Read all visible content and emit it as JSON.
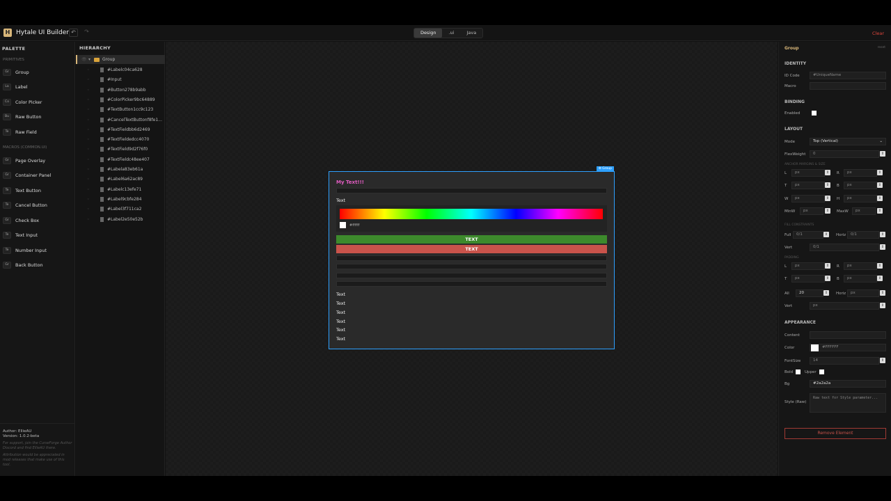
{
  "app": {
    "title": "Hytale UI Builder",
    "logo": "H",
    "undo": "↶",
    "redo": "↷",
    "clear_label": "Clear"
  },
  "modes": [
    {
      "label": "Design",
      "active": true
    },
    {
      "label": ".ui"
    },
    {
      "label": "Java"
    }
  ],
  "palette": {
    "title": "PALETTE",
    "primitives_title": "PRIMITIVES",
    "primitives": [
      {
        "badge": "Gr",
        "label": "Group"
      },
      {
        "badge": "La",
        "label": "Label"
      },
      {
        "badge": "Co",
        "label": "Color Picker"
      },
      {
        "badge": "Bu",
        "label": "Raw Button"
      },
      {
        "badge": "Te",
        "label": "Raw Field"
      }
    ],
    "macros_title": "MACROS (COMMON.UI)",
    "macros": [
      {
        "badge": "Gr",
        "label": "Page Overlay"
      },
      {
        "badge": "Gr",
        "label": "Container Panel"
      },
      {
        "badge": "Te",
        "label": "Text Button"
      },
      {
        "badge": "Te",
        "label": "Cancel Button"
      },
      {
        "badge": "Gr",
        "label": "Check Box"
      },
      {
        "badge": "Te",
        "label": "Text Input"
      },
      {
        "badge": "Te",
        "label": "Number Input"
      },
      {
        "badge": "Gr",
        "label": "Back Button"
      }
    ],
    "footer": {
      "author": "Author: EllieAU",
      "version": "Version: 1.0.2-beta",
      "support": "For support, join the CurseForge Author Discord and find EllieAU there.",
      "attribution": "Attribution would be appreciated in mod releases that make use of this tool."
    }
  },
  "hierarchy": {
    "title": "HIERARCHY",
    "root": "Group",
    "items": [
      "#Labelc04ca628",
      "#Input",
      "#Button278b9abb",
      "#ColorPicker9bc64889",
      "#TextButton1cc9c123",
      "#CancelTextButtonf8fe1...",
      "#TextFieldbb6d2469",
      "#TextFieldedcc4070",
      "#TextField9d2f76f0",
      "#TextFieldc48ee407",
      "#Labela83eb61a",
      "#Label6a62ac89",
      "#Labelc13efe71",
      "#Label9cbfe284",
      "#Label3f711ca2",
      "#Label2e50e52b"
    ]
  },
  "canvas": {
    "group_tag": "⚙ Group",
    "title_text": "My Text!!!",
    "text_label": "Text",
    "picker_hex": "#ffffff",
    "primary_button": "TEXT",
    "cancel_button": "TEXT",
    "labels": [
      "Text",
      "Text",
      "Text",
      "Text",
      "Text",
      "Text"
    ],
    "colors": {
      "title": "#e05cc0",
      "primary_button": "#3d8a2c",
      "cancel_button": "#c9534b",
      "selection": "#2ea0ff"
    }
  },
  "props": {
    "title": "Group",
    "reset": "reset",
    "identity": {
      "title": "IDENTITY",
      "id_label": "ID Code",
      "id_placeholder": "#UniqueName",
      "macro_label": "Macro"
    },
    "binding": {
      "title": "BINDING",
      "enabled_label": "Enabled"
    },
    "layout": {
      "title": "LAYOUT",
      "mode_label": "Mode",
      "mode_value": "Top (Vertical)",
      "flex_label": "FlexWeight",
      "flex_value": "0",
      "anchor_title": "ANCHOR MARGINS & SIZE",
      "l": "L",
      "r": "R",
      "t": "T",
      "b": "B",
      "w": "W",
      "h": "H",
      "minw": "MinW",
      "maxw": "MaxW",
      "px": "px",
      "fill_title": "FILL CONSTRAINTS",
      "full": "Full",
      "horiz": "Horiz",
      "vert": "Vert",
      "frac": "0/1",
      "padding_title": "PADDING",
      "all": "All",
      "all_value": "20"
    },
    "appearance": {
      "title": "APPEARANCE",
      "content_label": "Content",
      "color_label": "Color",
      "color_value": "#FFFFFF",
      "fontsize_label": "FontSize",
      "fontsize_value": "14",
      "bold_label": "Bold",
      "upper_label": "Upper",
      "bg_label": "Bg",
      "bg_value": "#2a2a2a",
      "style_label": "Style (Raw)",
      "style_placeholder": "Raw text for Style parameter..."
    },
    "remove_label": "Remove Element"
  }
}
